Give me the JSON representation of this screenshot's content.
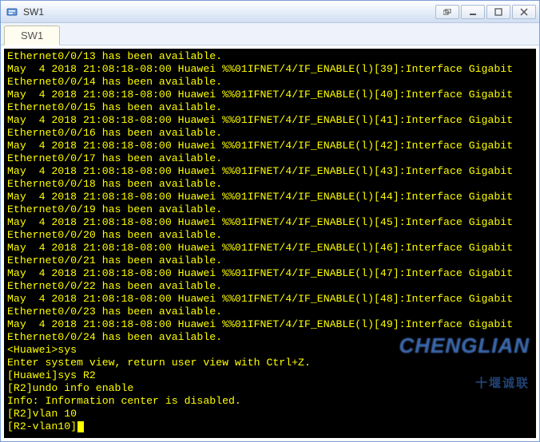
{
  "window": {
    "title": "SW1"
  },
  "tabs": [
    {
      "label": "SW1",
      "active": true
    }
  ],
  "terminal": {
    "lines": [
      "Ethernet0/0/13 has been available.",
      "May  4 2018 21:08:18-08:00 Huawei %%01IFNET/4/IF_ENABLE(l)[39]:Interface Gigabit",
      "Ethernet0/0/14 has been available.",
      "May  4 2018 21:08:18-08:00 Huawei %%01IFNET/4/IF_ENABLE(l)[40]:Interface Gigabit",
      "Ethernet0/0/15 has been available.",
      "May  4 2018 21:08:18-08:00 Huawei %%01IFNET/4/IF_ENABLE(l)[41]:Interface Gigabit",
      "Ethernet0/0/16 has been available.",
      "May  4 2018 21:08:18-08:00 Huawei %%01IFNET/4/IF_ENABLE(l)[42]:Interface Gigabit",
      "Ethernet0/0/17 has been available.",
      "May  4 2018 21:08:18-08:00 Huawei %%01IFNET/4/IF_ENABLE(l)[43]:Interface Gigabit",
      "Ethernet0/0/18 has been available.",
      "May  4 2018 21:08:18-08:00 Huawei %%01IFNET/4/IF_ENABLE(l)[44]:Interface Gigabit",
      "Ethernet0/0/19 has been available.",
      "May  4 2018 21:08:18-08:00 Huawei %%01IFNET/4/IF_ENABLE(l)[45]:Interface Gigabit",
      "Ethernet0/0/20 has been available.",
      "May  4 2018 21:08:18-08:00 Huawei %%01IFNET/4/IF_ENABLE(l)[46]:Interface Gigabit",
      "Ethernet0/0/21 has been available.",
      "May  4 2018 21:08:18-08:00 Huawei %%01IFNET/4/IF_ENABLE(l)[47]:Interface Gigabit",
      "Ethernet0/0/22 has been available.",
      "May  4 2018 21:08:18-08:00 Huawei %%01IFNET/4/IF_ENABLE(l)[48]:Interface Gigabit",
      "Ethernet0/0/23 has been available.",
      "May  4 2018 21:08:18-08:00 Huawei %%01IFNET/4/IF_ENABLE(l)[49]:Interface Gigabit",
      "Ethernet0/0/24 has been available.",
      "<Huawei>sys",
      "Enter system view, return user view with Ctrl+Z.",
      "[Huawei]sys R2",
      "[R2]undo info enable",
      "Info: Information center is disabled.",
      "[R2]vlan 10",
      "[R2-vlan10]"
    ]
  },
  "watermark": {
    "line1": "CHENGLIAN",
    "line2": "十堰诚联"
  }
}
